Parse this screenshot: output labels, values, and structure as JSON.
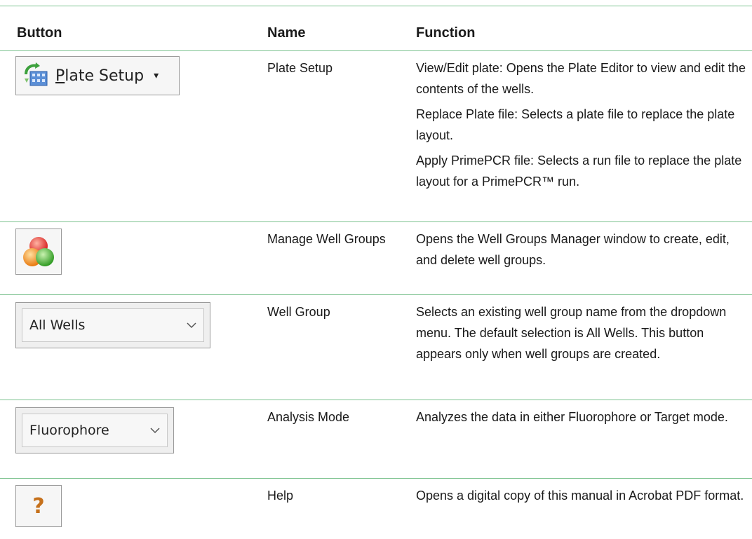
{
  "headers": {
    "button": "Button",
    "name": "Name",
    "function": "Function"
  },
  "rows": [
    {
      "button": {
        "label_underlined": "P",
        "label_rest": "late Setup",
        "caret": "▾",
        "icon": "plate-setup-icon"
      },
      "name": "Plate Setup",
      "function": [
        "View/Edit plate: Opens the Plate Editor to view and edit the contents of the wells.",
        "Replace Plate file: Selects a plate file to replace the plate layout.",
        "Apply PrimePCR file: Selects a run file to replace the plate layout for a PrimePCR™ run."
      ]
    },
    {
      "button": {
        "icon": "well-groups-icon"
      },
      "name": "Manage Well Groups",
      "function": [
        "Opens the Well Groups Manager window to create, edit, and delete well groups."
      ]
    },
    {
      "button": {
        "value": "All Wells",
        "icon": "chevron-down-icon"
      },
      "name": "Well Group",
      "function": [
        "Selects an existing well group name from the dropdown menu. The default selection is All Wells. This button appears only when well groups are created."
      ]
    },
    {
      "button": {
        "value": "Fluorophore",
        "icon": "chevron-down-icon"
      },
      "name": "Analysis Mode",
      "function": [
        "Analyzes the data in either Fluorophore or Target mode."
      ]
    },
    {
      "button": {
        "glyph": "?",
        "icon": "help-icon"
      },
      "name": "Help",
      "function": [
        "Opens a digital copy of this manual in Acrobat PDF format."
      ]
    }
  ],
  "colors": {
    "rule": "#7cc28f",
    "help": "#c6711c"
  }
}
